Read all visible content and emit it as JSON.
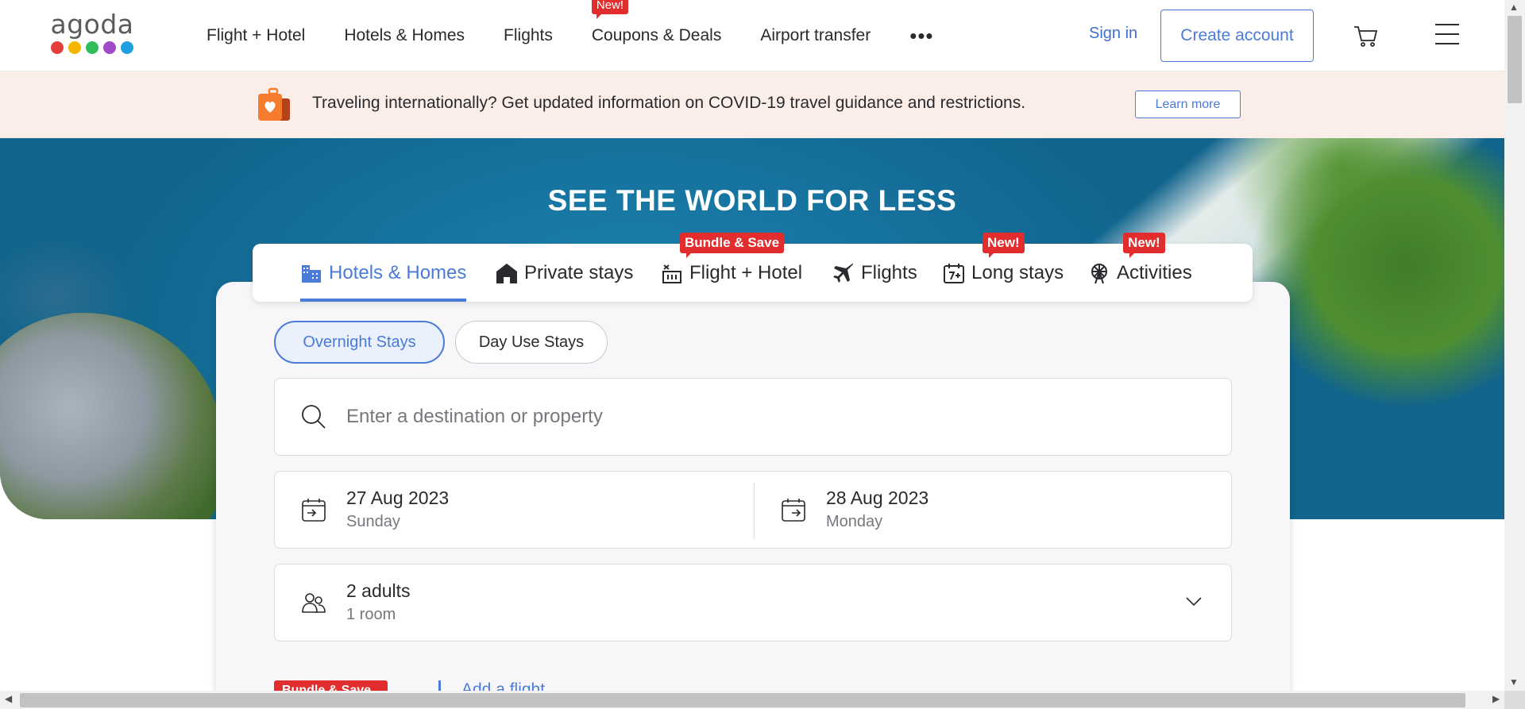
{
  "logo": {
    "text": "agoda",
    "dot_colors": [
      "#e43f3f",
      "#f7b500",
      "#2ebd59",
      "#a04ac9",
      "#1fa1e0"
    ]
  },
  "nav": {
    "links": [
      {
        "label": "Flight + Hotel"
      },
      {
        "label": "Hotels & Homes"
      },
      {
        "label": "Flights"
      },
      {
        "label": "Coupons & Deals",
        "badge": "New!"
      },
      {
        "label": "Airport transfer"
      }
    ],
    "more_icon": "more-dots-icon",
    "sign_in": "Sign in",
    "create_account": "Create account",
    "cart_icon": "cart-icon",
    "menu_icon": "hamburger-menu-icon"
  },
  "banner": {
    "icon": "luggage-heart-icon",
    "text": "Traveling internationally? Get updated information on COVID-19 travel guidance and restrictions.",
    "button": "Learn more"
  },
  "hero": {
    "title": "SEE THE WORLD FOR LESS"
  },
  "search": {
    "tabs": [
      {
        "label": "Hotels & Homes",
        "icon": "hotel-building-icon",
        "active": true
      },
      {
        "label": "Private stays",
        "icon": "house-icon"
      },
      {
        "label": "Flight + Hotel",
        "icon": "flight-hotel-icon",
        "badge": "Bundle & Save"
      },
      {
        "label": "Flights",
        "icon": "airplane-icon"
      },
      {
        "label": "Long stays",
        "icon": "calendar-7-icon",
        "badge": "New!"
      },
      {
        "label": "Activities",
        "icon": "ferris-wheel-icon",
        "badge": "New!"
      }
    ],
    "stay_types": {
      "active": "Overnight Stays",
      "inactive": "Day Use Stays"
    },
    "destination": {
      "placeholder": "Enter a destination or property",
      "value": ""
    },
    "check_in": {
      "date": "27 Aug 2023",
      "day": "Sunday"
    },
    "check_out": {
      "date": "28 Aug 2023",
      "day": "Monday"
    },
    "occupancy": {
      "adults": "2 adults",
      "rooms": "1 room"
    },
    "bottom_badge": "Bundle & Save",
    "add_flight": "Add a flight"
  },
  "colors": {
    "accent": "#4a7bd8",
    "badge_red": "#e12d2d",
    "banner_bg": "#fbeee9"
  }
}
